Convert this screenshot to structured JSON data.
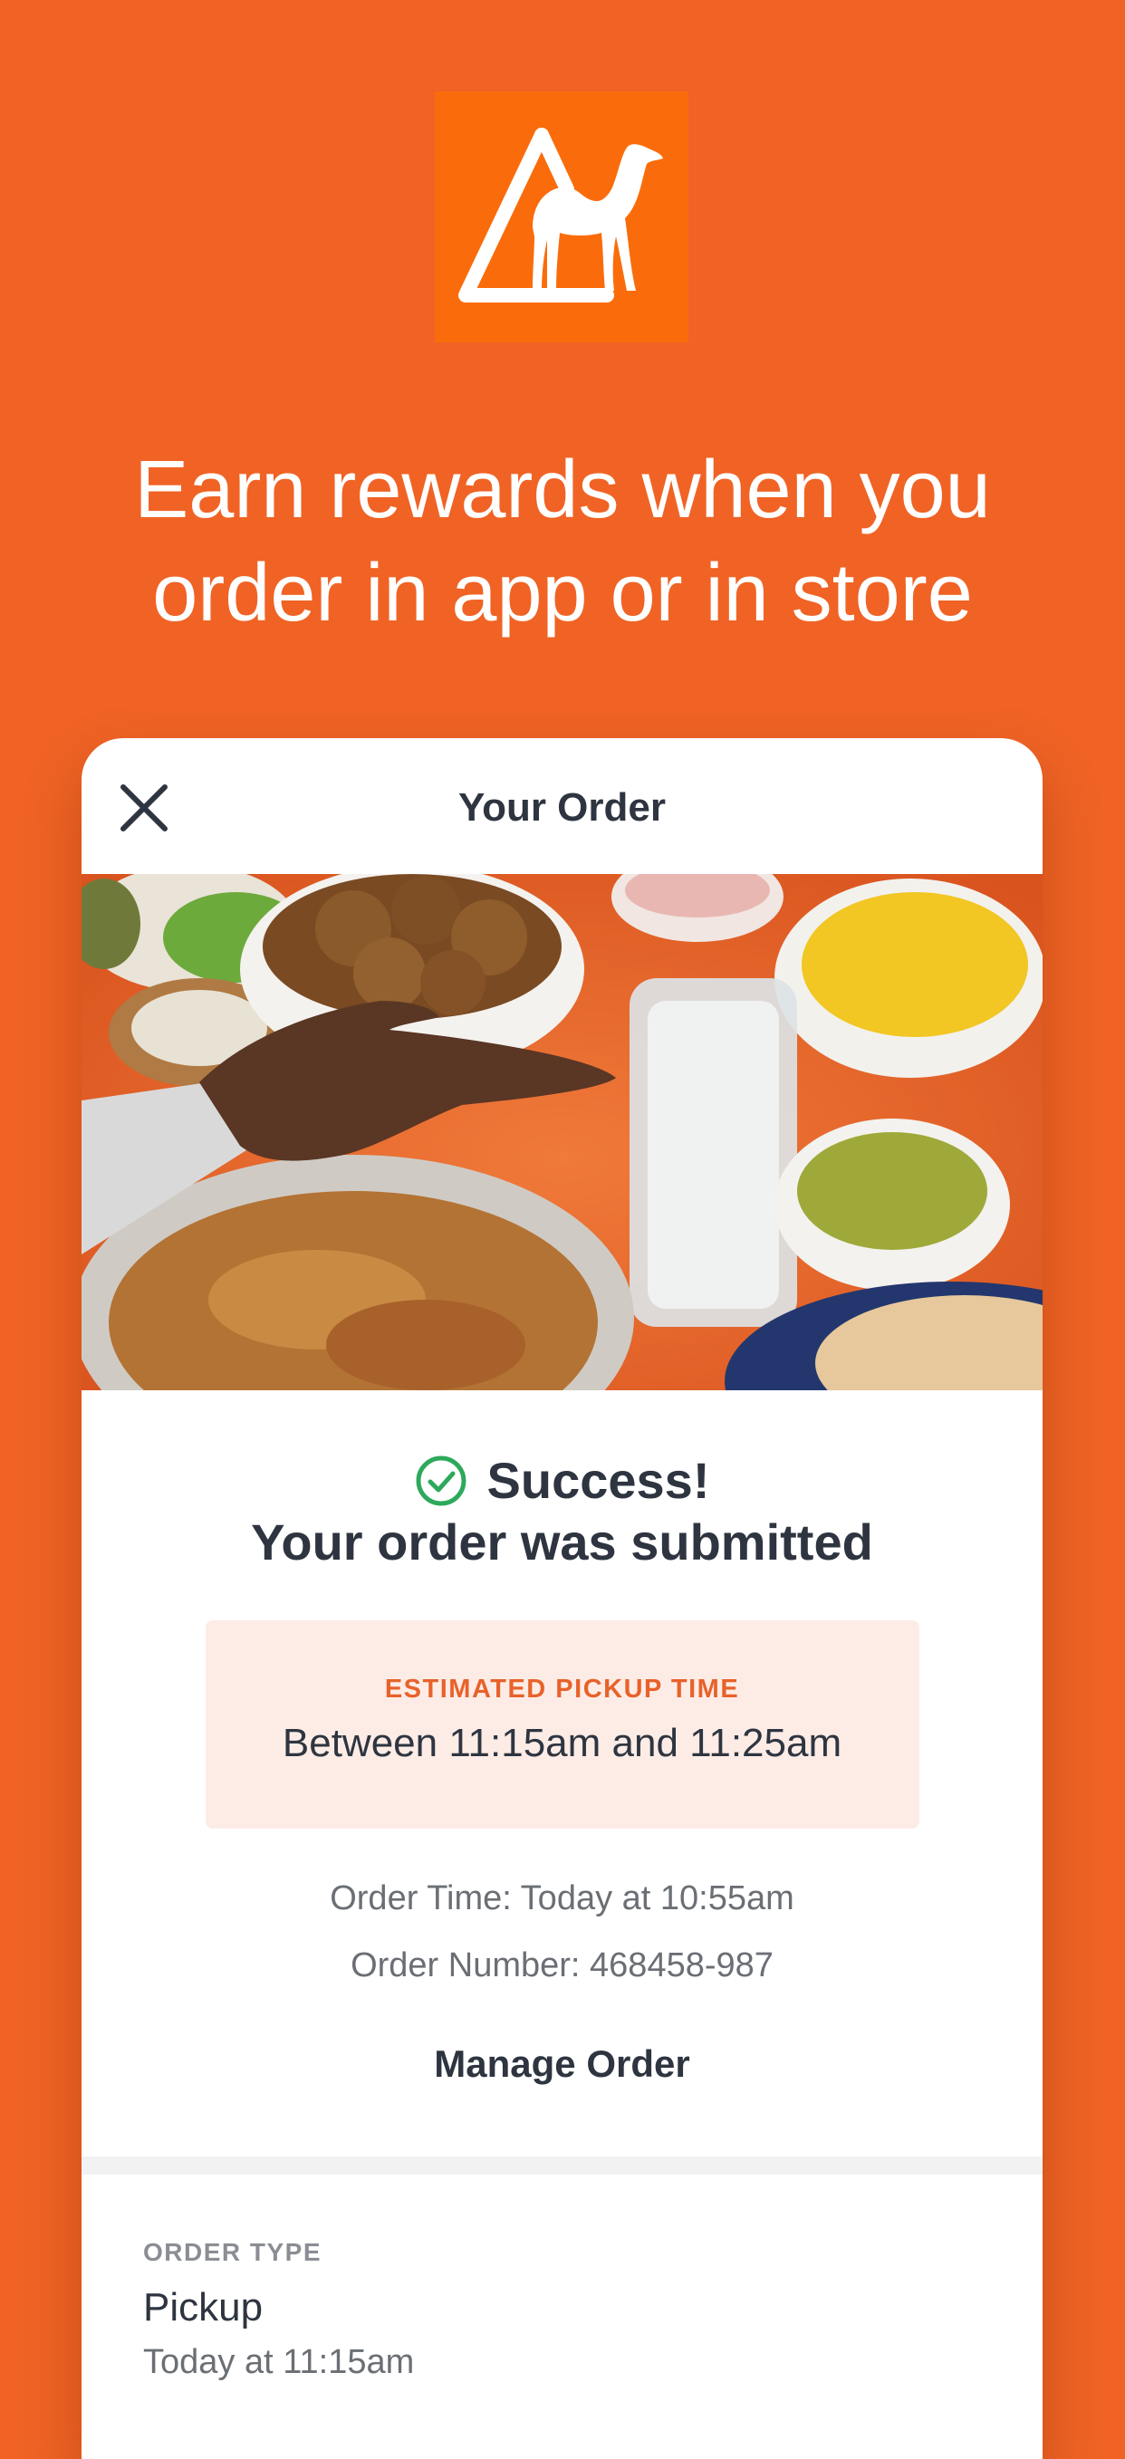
{
  "headline": {
    "line1": "Earn rewards when you",
    "line2": "order in app or in store"
  },
  "card": {
    "title": "Your Order",
    "success_title": "Success!",
    "success_subtitle": "Your order was submitted",
    "pickup": {
      "label": "ESTIMATED PICKUP TIME",
      "value": "Between 11:15am and 11:25am"
    },
    "order_time": "Order Time: Today at 10:55am",
    "order_number": "Order Number: 468458-987",
    "manage_label": "Manage Order",
    "order_type": {
      "label": "ORDER TYPE",
      "value": "Pickup",
      "time": "Today at 11:15am"
    }
  },
  "icons": {
    "logo": "camel-logo-icon",
    "close": "close-icon",
    "success": "check-circle-icon"
  },
  "colors": {
    "background": "#F06325",
    "brand": "#FA6C0B",
    "accent_text": "#E8622A",
    "success_green": "#2EA95C",
    "pickup_bg": "#FDECE6",
    "dark_text": "#2E3540"
  }
}
